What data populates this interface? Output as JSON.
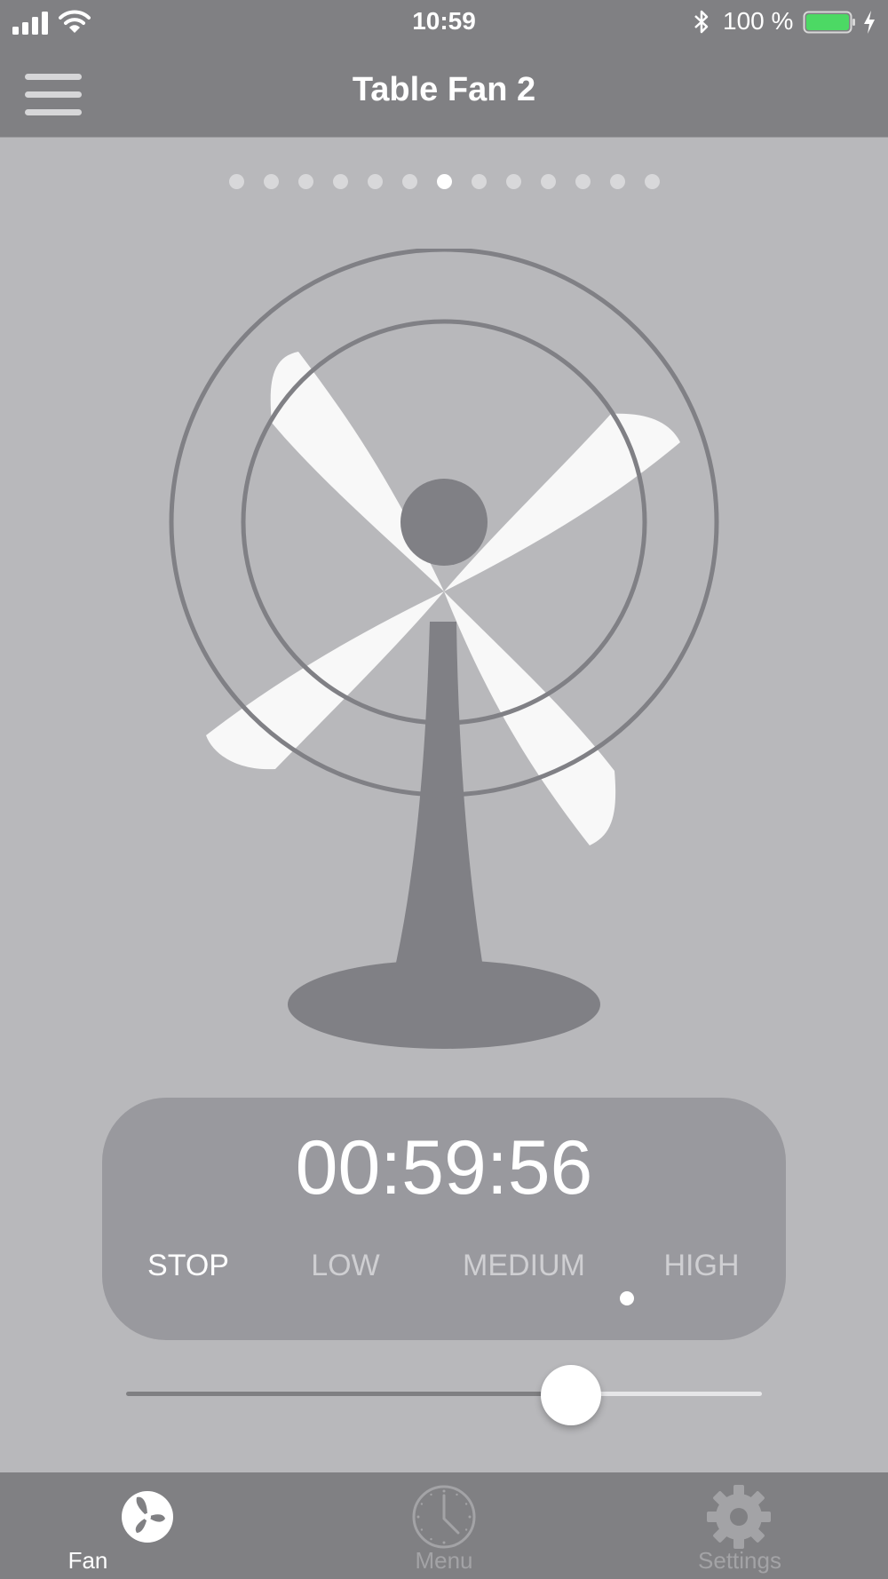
{
  "status_bar": {
    "time": "10:59",
    "battery_percent": "100 %",
    "battery_level": 1.0,
    "battery_color": "#4cd964"
  },
  "nav": {
    "title": "Table Fan 2",
    "menu_icon": "hamburger-icon"
  },
  "pager": {
    "count": 13,
    "active_index": 6
  },
  "timer": {
    "display": "00:59:56"
  },
  "speed": {
    "options": [
      "STOP",
      "LOW",
      "MEDIUM",
      "HIGH"
    ],
    "highlighted_label_index": 0,
    "selected_index": 2
  },
  "slider": {
    "value": 0.7
  },
  "tabs": [
    {
      "label": "Fan",
      "icon": "fan-icon",
      "active": true
    },
    {
      "label": "Menu",
      "icon": "clock-icon",
      "active": false
    },
    {
      "label": "Settings",
      "icon": "gear-icon",
      "active": false
    }
  ],
  "colors": {
    "background": "#b8b8bb",
    "bar": "#808083",
    "fan_body": "#808085",
    "blade": "#f8f8f8",
    "panel": "#99999e"
  }
}
